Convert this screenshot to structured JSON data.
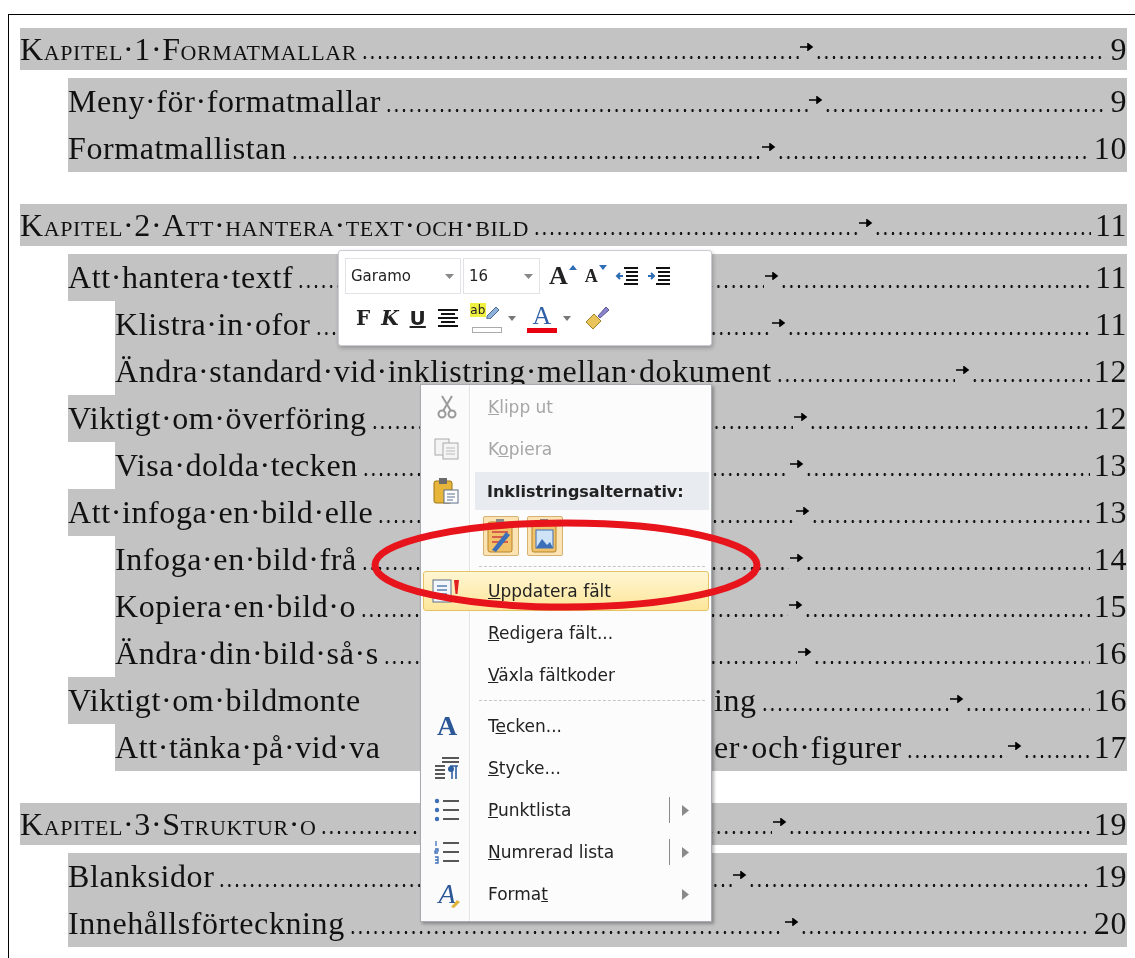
{
  "toc": [
    {
      "title": "Kapitel·1·Formatmallar",
      "page": "9",
      "children": [
        {
          "title": "Meny·för·formatmallar",
          "page": "9"
        },
        {
          "title": "Formatmallistan",
          "page": "10"
        }
      ]
    },
    {
      "title": "Kapitel·2·Att·hantera·text·och·bild",
      "page": "11",
      "children": [
        {
          "title": "Att·hantera·textf",
          "page": "11",
          "children": [
            {
              "title": "Klistra·in·ofor",
              "page": "11"
            },
            {
              "title": "Ändra·standard·vid·inklistring·mellan·dokument",
              "page": "12"
            }
          ]
        },
        {
          "title": "Viktigt·om·överföring",
          "page": "12",
          "children": [
            {
              "title": "Visa·dolda·tecken",
              "page": "13"
            }
          ]
        },
        {
          "title": "Att·infoga·en·bild·elle",
          "page": "13",
          "children": [
            {
              "title": "Infoga·en·bild·frå",
              "page": "14"
            },
            {
              "title": "Kopiera·en·bild·o",
              "page": "15"
            },
            {
              "title": "Ändra·din·bild·så·s",
              "page": "16"
            }
          ]
        },
        {
          "title": "Viktigt·om·bildmonte",
          "title_after": "ing",
          "page": "16",
          "children": [
            {
              "title": "Att·tänka·på·vid·va",
              "title_after": "er·och·figurer",
              "page": "17"
            }
          ]
        }
      ]
    },
    {
      "title": "Kapitel·3·Struktur·o",
      "page": "19",
      "children": [
        {
          "title": "Blanksidor",
          "page": "19"
        },
        {
          "title": "Innehållsförteckning",
          "page": "20"
        }
      ]
    }
  ],
  "mini_toolbar": {
    "font": "Garamo",
    "size": "16",
    "row1": [
      {
        "kind": "grow_font",
        "label": "A",
        "dropdown": false
      },
      {
        "kind": "shrink_font",
        "label": "A",
        "dropdown": false
      },
      {
        "kind": "outdent",
        "dropdown": false
      },
      {
        "kind": "indent",
        "dropdown": false
      }
    ],
    "row2": [
      {
        "kind": "bold",
        "label": "F",
        "dropdown": false
      },
      {
        "kind": "italic",
        "label": "K",
        "dropdown": false
      },
      {
        "kind": "underline",
        "label": "U",
        "dropdown": false
      },
      {
        "kind": "center",
        "dropdown": false
      },
      {
        "kind": "highlight",
        "label": "ab",
        "dropdown": true
      },
      {
        "kind": "font_color",
        "label": "A",
        "dropdown": true
      },
      {
        "kind": "format_painter",
        "dropdown": false
      }
    ]
  },
  "menu": {
    "items": [
      {
        "kind": "command",
        "accel": "K",
        "post": "lipp ut",
        "disabled": true,
        "selected": false,
        "submenu": false,
        "split": false
      },
      {
        "kind": "command",
        "pre": "K",
        "accel": "o",
        "post": "piera",
        "disabled": true,
        "selected": false,
        "submenu": false,
        "split": false
      },
      {
        "kind": "header",
        "label": "Inklistringsalternativ:"
      },
      {
        "kind": "paste_options"
      },
      {
        "kind": "separator"
      },
      {
        "kind": "command",
        "accel": "U",
        "post": "ppdatera fält",
        "disabled": false,
        "selected": true,
        "submenu": false,
        "split": false
      },
      {
        "kind": "command",
        "accel": "R",
        "post": "edigera fält...",
        "disabled": false,
        "selected": false,
        "submenu": false,
        "split": false
      },
      {
        "kind": "command",
        "accel": "V",
        "post": "äxla fältkoder",
        "disabled": false,
        "selected": false,
        "submenu": false,
        "split": false
      },
      {
        "kind": "separator"
      },
      {
        "kind": "command",
        "icon_label": "A",
        "pre": "T",
        "accel": "e",
        "post": "cken...",
        "disabled": false,
        "selected": false,
        "submenu": false,
        "split": false
      },
      {
        "kind": "command",
        "accel": "S",
        "post": "tycke...",
        "disabled": false,
        "selected": false,
        "submenu": false,
        "split": false
      },
      {
        "kind": "command",
        "accel": "P",
        "post": "unktlista",
        "disabled": false,
        "selected": false,
        "submenu": true,
        "split": true
      },
      {
        "kind": "command",
        "accel": "N",
        "post": "umrerad lista",
        "disabled": false,
        "selected": false,
        "submenu": true,
        "split": true
      },
      {
        "kind": "command",
        "icon_label": "A",
        "pre": "Forma",
        "accel": "t",
        "disabled": false,
        "selected": false,
        "submenu": true,
        "split": false
      }
    ]
  }
}
